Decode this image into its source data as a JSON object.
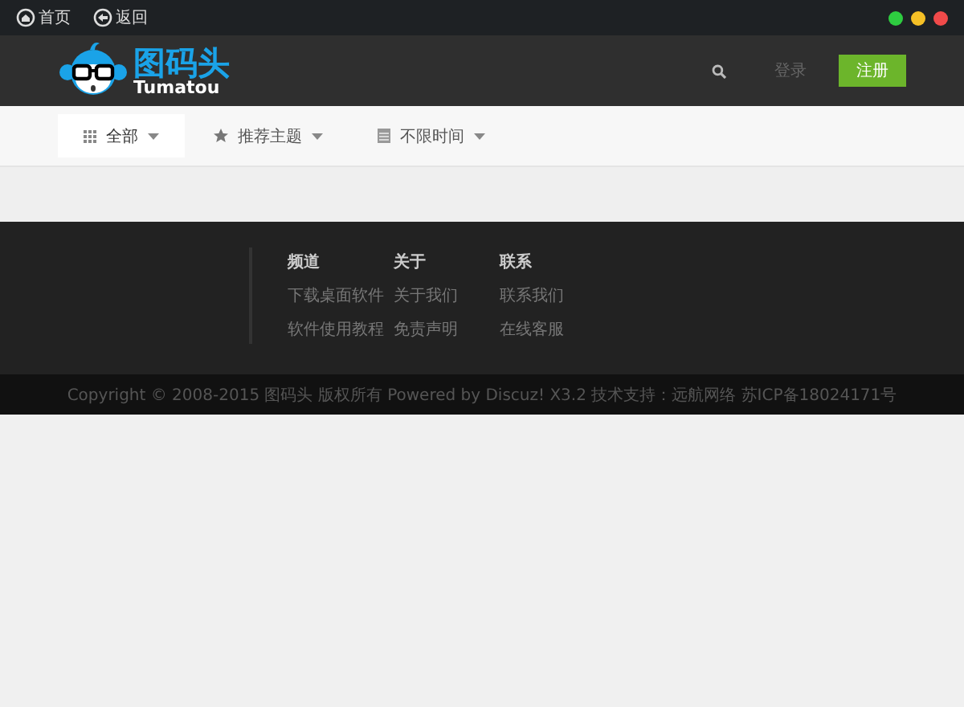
{
  "top_bar": {
    "nav": [
      {
        "kind": "home",
        "label": "首页"
      },
      {
        "kind": "back",
        "label": "返回"
      }
    ],
    "window_dots": [
      {
        "color": "#2ecc40"
      },
      {
        "color": "#f5c026"
      },
      {
        "color": "#f04a4a"
      }
    ]
  },
  "header": {
    "logo": {
      "title": "图码头",
      "subtitle": "Tumatou"
    },
    "login": "登录",
    "register": "注册"
  },
  "filters": [
    {
      "kind": "grid",
      "label": "全部",
      "selected": true
    },
    {
      "kind": "star",
      "label": "推荐主题",
      "selected": false
    },
    {
      "kind": "calendar",
      "label": "不限时间",
      "selected": false
    }
  ],
  "footer": {
    "columns": [
      {
        "title": "频道",
        "links": [
          "下载桌面软件",
          "软件使用教程"
        ]
      },
      {
        "title": "关于",
        "links": [
          "关于我们",
          "免责声明"
        ]
      },
      {
        "title": "联系",
        "links": [
          "联系我们",
          "在线客服"
        ]
      }
    ],
    "copyright": "Copyright © 2008-2015 图码头 版权所有 Powered by Discuz! X3.2 技术支持：远航网络 苏ICP备18024171号"
  }
}
